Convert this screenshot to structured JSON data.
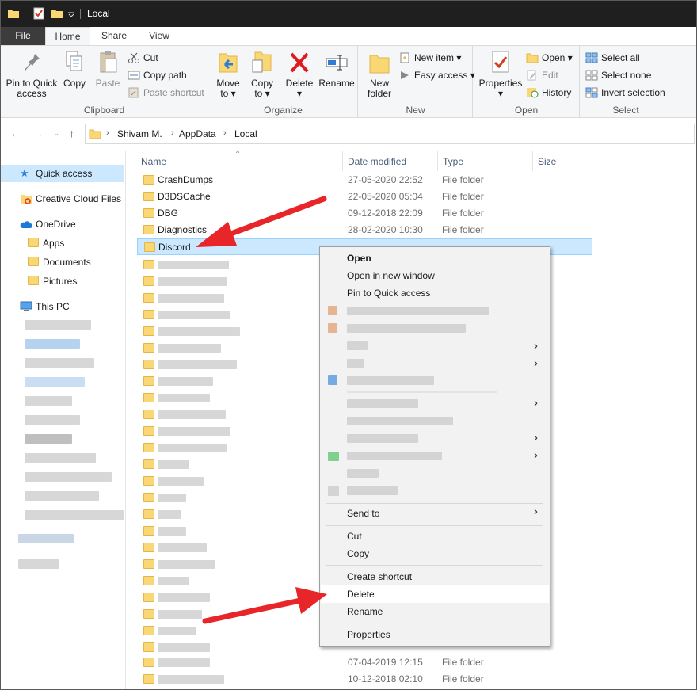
{
  "window": {
    "title": "Local",
    "tabs": {
      "file": "File",
      "home": "Home",
      "share": "Share",
      "view": "View"
    }
  },
  "ribbon": {
    "clipboard": {
      "label": "Clipboard",
      "pin_line1": "Pin to Quick",
      "pin_line2": "access",
      "copy": "Copy",
      "paste": "Paste",
      "cut": "Cut",
      "copy_path": "Copy path",
      "paste_shortcut": "Paste shortcut"
    },
    "organize": {
      "label": "Organize",
      "move_line1": "Move",
      "move_line2": "to",
      "copy_line1": "Copy",
      "copy_line2": "to",
      "delete": "Delete",
      "rename": "Rename"
    },
    "new": {
      "label": "New",
      "folder_line1": "New",
      "folder_line2": "folder",
      "new_item": "New item",
      "easy_access": "Easy access"
    },
    "open": {
      "label": "Open",
      "properties": "Properties",
      "open": "Open",
      "edit": "Edit",
      "history": "History"
    },
    "select": {
      "label": "Select",
      "select_all": "Select all",
      "select_none": "Select none",
      "invert": "Invert selection"
    }
  },
  "address": {
    "crumbs": [
      "Shivam M.",
      "AppData",
      "Local"
    ]
  },
  "navpane": {
    "quick_access": "Quick access",
    "creative_cloud": "Creative Cloud Files",
    "onedrive": "OneDrive",
    "apps": "Apps",
    "documents": "Documents",
    "pictures": "Pictures",
    "this_pc": "This PC"
  },
  "columns": {
    "name": "Name",
    "date": "Date modified",
    "type": "Type",
    "size": "Size"
  },
  "files": [
    {
      "name": "CrashDumps",
      "date": "27-05-2020 22:52",
      "type": "File folder"
    },
    {
      "name": "D3DSCache",
      "date": "22-05-2020 05:04",
      "type": "File folder"
    },
    {
      "name": "DBG",
      "date": "09-12-2018 22:09",
      "type": "File folder"
    },
    {
      "name": "Diagnostics",
      "date": "28-02-2020 10:30",
      "type": "File folder"
    },
    {
      "name": "Discord",
      "date": "",
      "type": ""
    }
  ],
  "tail_files": [
    {
      "date": "07-04-2019 12:15",
      "type": "File folder"
    },
    {
      "date": "10-12-2018 02:10",
      "type": "File folder"
    }
  ],
  "context_menu": {
    "open": "Open",
    "open_new_window": "Open in new window",
    "pin_quick": "Pin to Quick access",
    "send_to": "Send to",
    "cut": "Cut",
    "copy": "Copy",
    "create_shortcut": "Create shortcut",
    "delete": "Delete",
    "rename": "Rename",
    "properties": "Properties"
  },
  "colors": {
    "selection": "#cce8ff",
    "arrow": "#e8262a",
    "titlebar": "#1f1f1f"
  }
}
